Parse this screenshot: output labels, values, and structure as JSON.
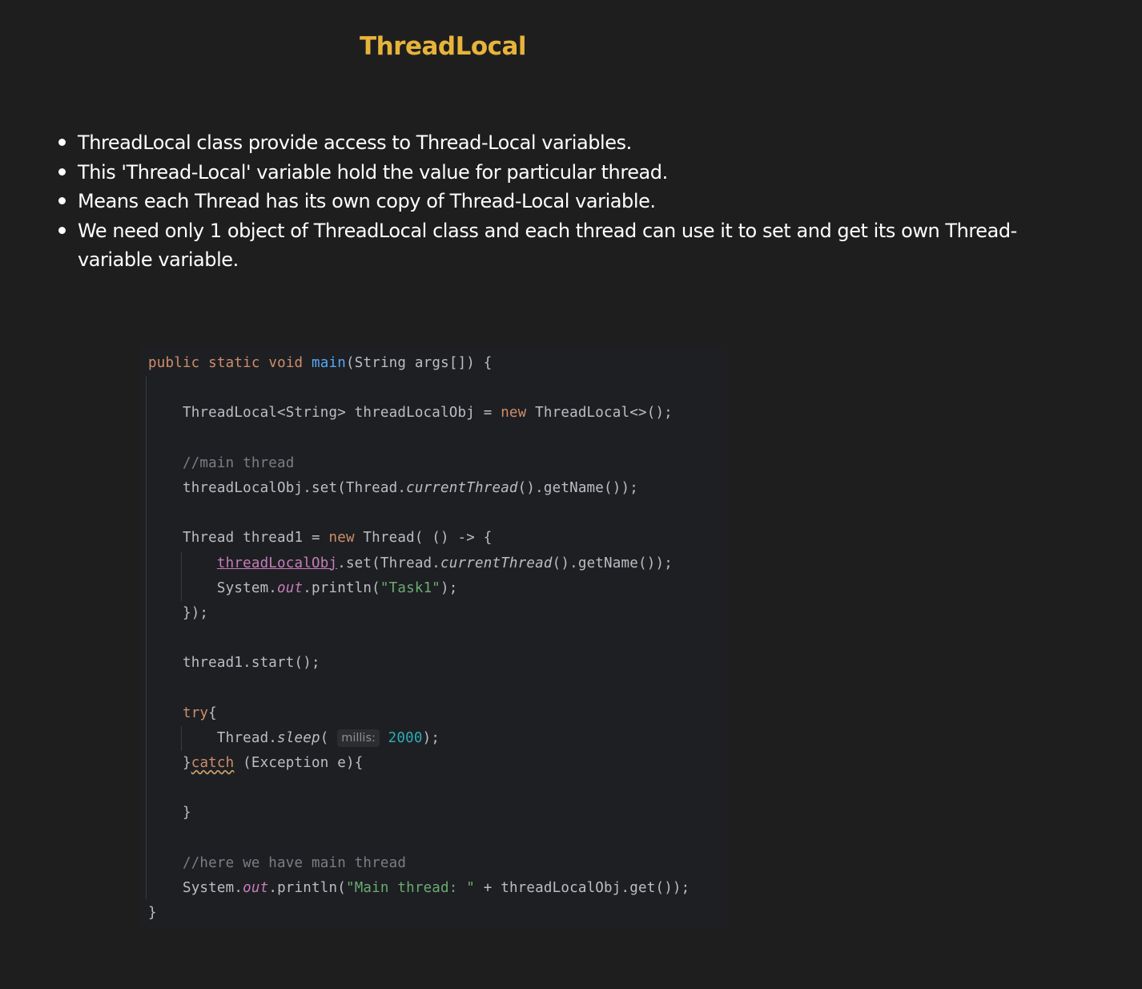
{
  "title": "ThreadLocal",
  "bullets": [
    "ThreadLocal class provide access to Thread-Local variables.",
    "This 'Thread-Local' variable hold the value for particular thread.",
    "Means each Thread has its own copy of Thread-Local variable.",
    "We need only 1 object of ThreadLocal class and each thread can use it to set and get its own Thread-variable variable."
  ],
  "code": {
    "kw_public": "public",
    "kw_static": "static",
    "kw_void": "void",
    "fn_main": "main",
    "sig_rest": "(String args[]) {",
    "decl_type": "ThreadLocal<String> threadLocalObj = ",
    "kw_new": "new",
    "decl_ctor": " ThreadLocal<>();",
    "comment_main": "//main thread",
    "set_prefix": "threadLocalObj.set(Thread.",
    "current_thread": "currentThread",
    "set_suffix": "().getName());",
    "thread_decl": "Thread thread1 = ",
    "thread_ctor": " Thread( () -> {",
    "captured_var": "threadLocalObj",
    "set_inner_prefix": ".set(Thread.",
    "system_prefix": "System.",
    "out": "out",
    "println_prefix": ".println(",
    "task_string": "\"Task1\"",
    "println_suffix": ");",
    "lambda_close": "});",
    "thread_start": "thread1.start();",
    "kw_try": "try",
    "brace_open": "{",
    "sleep_prefix": "Thread.",
    "sleep": "sleep",
    "paren_open": "( ",
    "param_hint": "millis:",
    "sleep_value": "2000",
    "sleep_suffix": ");",
    "brace_close": "}",
    "kw_catch": "catch",
    "catch_rest": " (Exception e){",
    "comment_here": "//here we have main thread",
    "main_string": "\"Main thread: \"",
    "concat_get": " + threadLocalObj.get());"
  },
  "colors": {
    "background": "#1f1e1e",
    "title": "#e6b43a",
    "code_background": "#1e1f22",
    "keyword": "#cf8e6d",
    "function": "#56a8f5",
    "comment": "#7a7e85",
    "string": "#6aab73",
    "static_field": "#c77dbb",
    "number": "#2aacb8"
  }
}
